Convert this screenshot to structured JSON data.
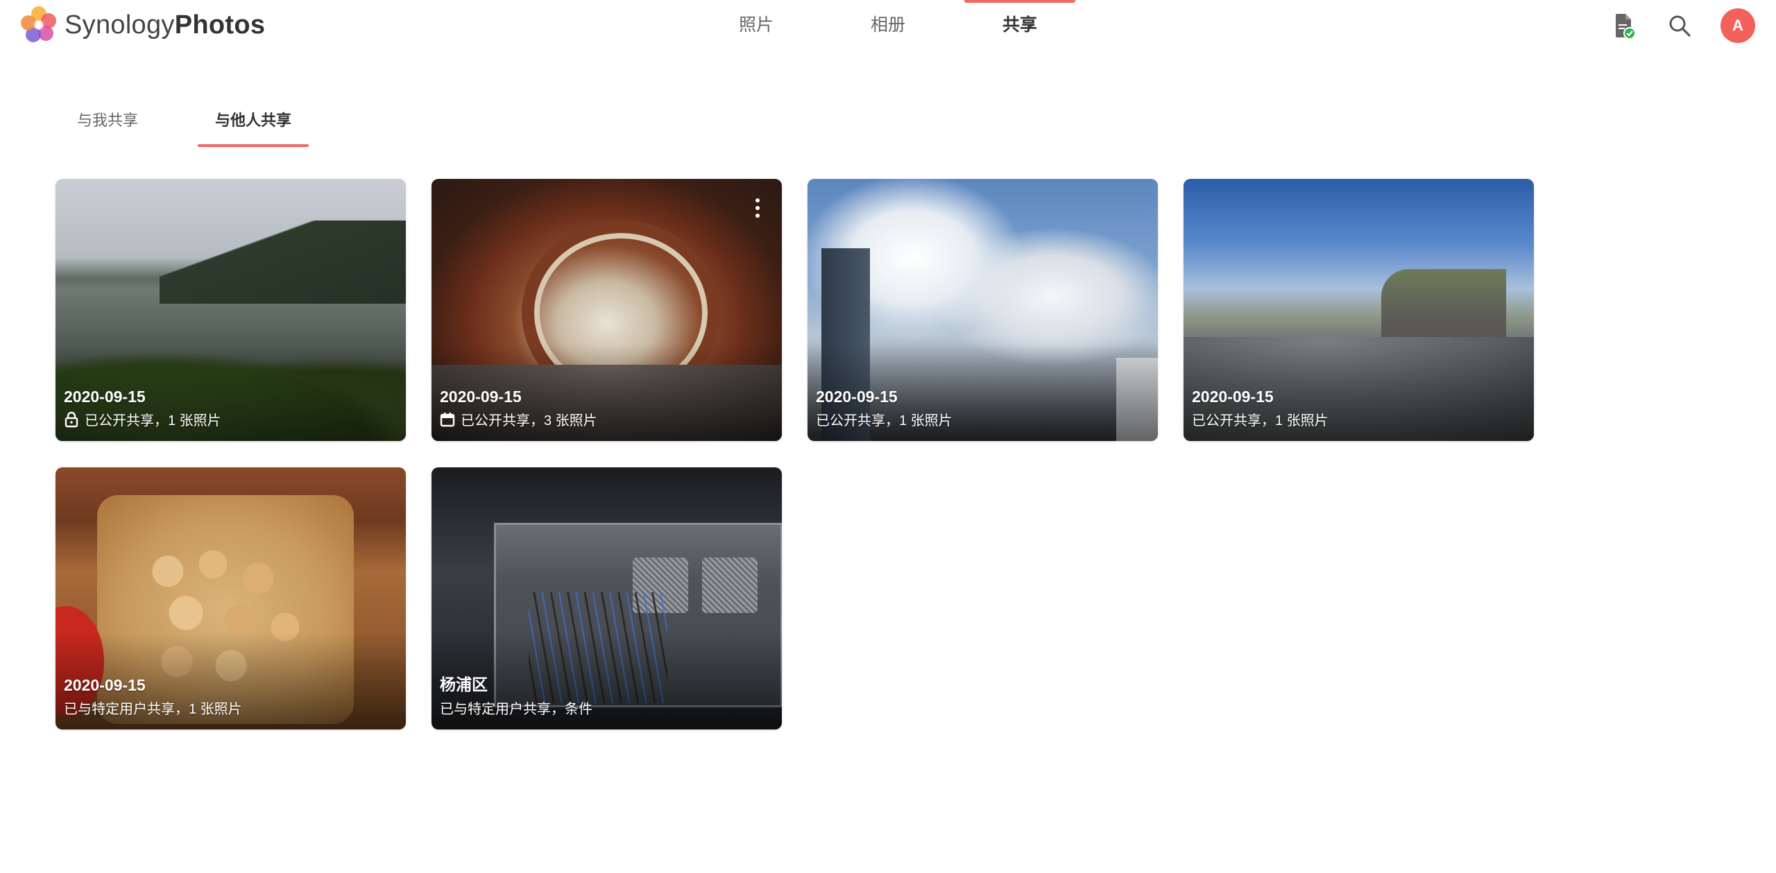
{
  "app": {
    "brand_part1": "Synology",
    "brand_part2": "Photos",
    "accent_color": "#f06860"
  },
  "nav": {
    "tabs": [
      {
        "label": "照片",
        "active": false
      },
      {
        "label": "相册",
        "active": false
      },
      {
        "label": "共享",
        "active": true
      }
    ]
  },
  "toolbar": {
    "icons": [
      "file-status-icon",
      "search-icon"
    ],
    "avatar_letter": "A",
    "avatar_color": "#f2625a"
  },
  "subtabs": [
    {
      "label": "与我共享",
      "active": false
    },
    {
      "label": "与他人共享",
      "active": true
    }
  ],
  "albums": [
    {
      "title": "2020-09-15",
      "meta": "已公开共享，1 张照片",
      "meta_icon": "lock-icon"
    },
    {
      "title": "2020-09-15",
      "meta": "已公开共享，3 张照片",
      "meta_icon": "calendar-icon",
      "has_more_menu": true
    },
    {
      "title": "2020-09-15",
      "meta": "已公开共享，1 张照片"
    },
    {
      "title": "2020-09-15",
      "meta": "已公开共享，1 张照片"
    },
    {
      "title": "2020-09-15",
      "meta": "已与特定用户共享，1 张照片"
    },
    {
      "title": "杨浦区",
      "meta": "已与特定用户共享，条件"
    }
  ]
}
